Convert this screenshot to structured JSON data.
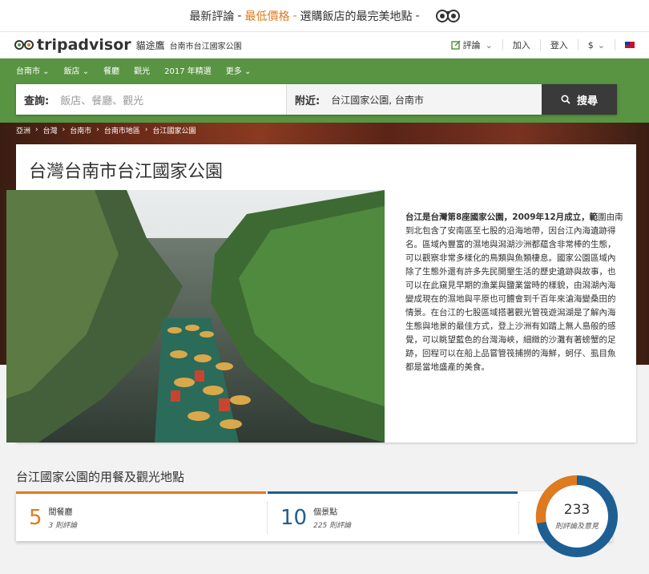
{
  "promo": {
    "part1": "最新評論",
    "sep": "-",
    "part2": "最低價格",
    "part3": "選購飯店的最完美地點"
  },
  "header": {
    "logo_text": "tripadvisor",
    "brand_cn": "貓途鷹",
    "location": "台南市台江國家公園",
    "review_label": "評論",
    "join_label": "加入",
    "login_label": "登入",
    "currency_label": "$"
  },
  "nav": {
    "items": [
      "台南市 ⌄",
      "飯店 ⌄",
      "餐廳",
      "觀光",
      "2017 年精選",
      "更多 ⌄"
    ]
  },
  "search": {
    "query_label": "查詢:",
    "query_placeholder": "飯店、餐廳、觀光",
    "near_label": "附近:",
    "near_value": "台江國家公園, 台南市",
    "button_label": "搜尋"
  },
  "breadcrumb": [
    "亞洲",
    "台灣",
    "台南市",
    "台南市地區",
    "台江國家公園"
  ],
  "page": {
    "title": "台灣台南市台江國家公園",
    "desc_bold": "台江是台灣第8座國家公園，2009年12月成立，範",
    "desc_rest": "圍由南到北包含了安南區至七股的沿海地帶，因台江內海遺跡得名。區域內豐富的濕地與潟湖沙洲都蘊含非常棒的生態，可以觀察非常多樣化的鳥類與魚類棲息。國家公園區域內除了生態外還有許多先民開墾生活的歷史遺跡與故事，也可以在此窺見早期的漁業與鹽業當時的樣貌，由潟湖內海變成現在的濕地與平原也可體會到千百年來滄海變桑田的情景。在台江的七股區域搭著觀光管筏遊潟湖是了解內海生態與地景的最佳方式，登上沙洲有如踏上無人島般的感覺，可以眺望藍色的台灣海峽，細緻的沙灘有著螃蟹的足跡，回程可以在船上品嘗管筏捕撈的海鮮，蚵仔、虱目魚都是當地盛產的美食。"
  },
  "section": {
    "title": "台江國家公園的用餐及觀光地點",
    "stats": [
      {
        "num": "5",
        "label": "間餐廳",
        "sub": "3 則評論",
        "color": "#e07a1f"
      },
      {
        "num": "10",
        "label": "個景點",
        "sub": "225 則評論",
        "color": "#1d5f92"
      }
    ],
    "total": {
      "num": "233",
      "label": "則評論及意見"
    }
  }
}
